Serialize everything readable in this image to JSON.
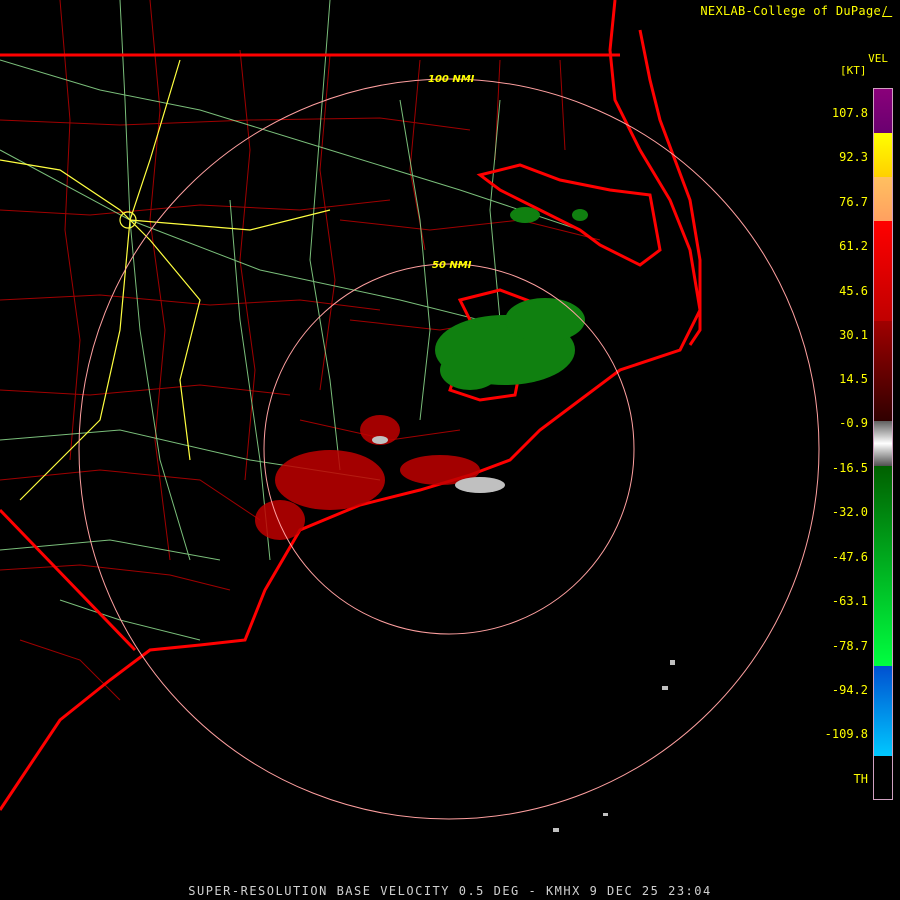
{
  "header": {
    "credit": "NEXLAB-College of DuPage"
  },
  "legend": {
    "product": "VEL",
    "unit": "[KT]",
    "ticks": [
      "107.8",
      "92.3",
      "76.7",
      "61.2",
      "45.6",
      "30.1",
      "14.5",
      "-0.9",
      "-16.5",
      "-32.0",
      "-47.6",
      "-63.1",
      "-78.7",
      "-94.2",
      "-109.8",
      "TH"
    ],
    "colors": {
      "purple": "#8a007a",
      "yellow": "#ffff00",
      "orange": "#ffa060",
      "red": "#ff0000",
      "darkred": "#800000",
      "gray": "#909090",
      "green": "#20c020",
      "darkgreen": "#006000",
      "blue": "#0050d0",
      "cyan": "#00c8ff",
      "black": "#000000"
    }
  },
  "map": {
    "ring_labels": [
      "100 NMI",
      "50 NMI"
    ],
    "colors": {
      "state_border": "#ff0000",
      "county": "#a00000",
      "roads": "#90e090",
      "interstate": "#ffff40",
      "range_ring": "#ffa0a0",
      "echo_green": "#108010",
      "echo_red": "#c00000"
    }
  },
  "footer": {
    "caption": "SUPER-RESOLUTION BASE VELOCITY 0.5 DEG - KMHX 9 DEC 25 23:04"
  }
}
